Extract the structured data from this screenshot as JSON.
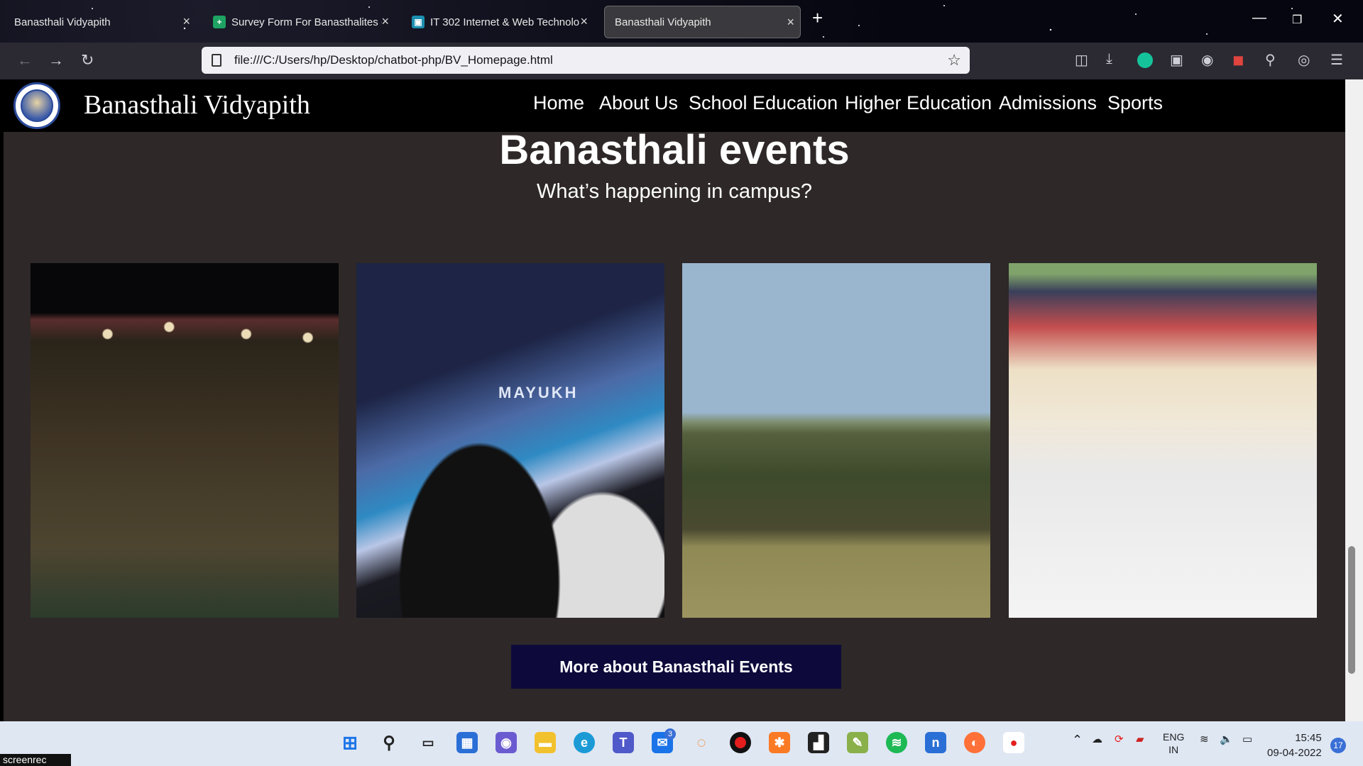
{
  "browser": {
    "tabs": [
      {
        "title": "Banasthali Vidyapith"
      },
      {
        "title": "Survey Form For Banasthalites ("
      },
      {
        "title": "IT 302 Internet & Web Technolo"
      },
      {
        "title": "Banasthali Vidyapith"
      }
    ],
    "new_tab": "+",
    "url": "file:///C:/Users/hp/Desktop/chatbot-php/BV_Homepage.html"
  },
  "site": {
    "title": "Banasthali Vidyapith",
    "menu": [
      "Home",
      "About Us",
      "School Education",
      "Higher Education",
      "Admissions",
      "Sports"
    ]
  },
  "events": {
    "title": "Banasthali events",
    "subtitle": "What’s happening in campus?",
    "photo2_text": "MAYUKH",
    "button": "More about Banasthali Events"
  },
  "taskbar": {
    "badge_mail": "3",
    "lang": "ENG",
    "region": "IN",
    "time": "15:45",
    "date": "09-04-2022",
    "notif_count": "17",
    "screenrec": "screenrec"
  }
}
